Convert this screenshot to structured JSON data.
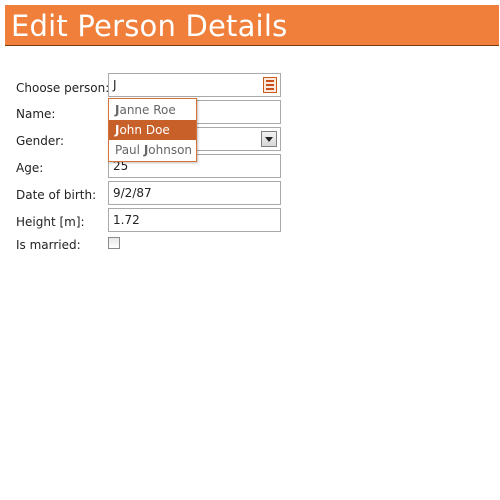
{
  "header": {
    "title": "Edit Person Details",
    "bg_color": "#ef7f3a"
  },
  "form": {
    "choose_person": {
      "label": "Choose person:",
      "value": "J",
      "icon": "list-icon"
    },
    "name": {
      "label": "Name:",
      "value": ""
    },
    "gender": {
      "label": "Gender:",
      "value": "",
      "icon": "chevron-down-icon"
    },
    "age": {
      "label": "Age:",
      "value": "25"
    },
    "date_of_birth": {
      "label": "Date of birth:",
      "value": "9/2/87"
    },
    "height": {
      "label": "Height [m]:",
      "value": "1.72"
    },
    "is_married": {
      "label": "Is married:",
      "checked": false
    }
  },
  "autocomplete": {
    "query": "J",
    "items": [
      {
        "match": "J",
        "rest": "anne Roe",
        "full": "Janne Roe",
        "selected": false
      },
      {
        "match": "J",
        "rest": "ohn Doe",
        "full": "John Doe",
        "selected": true
      },
      {
        "pre": "Paul ",
        "match": "J",
        "rest": "ohnson",
        "full": "Paul Johnson",
        "selected": false
      }
    ],
    "highlight_color": "#c8602a"
  }
}
